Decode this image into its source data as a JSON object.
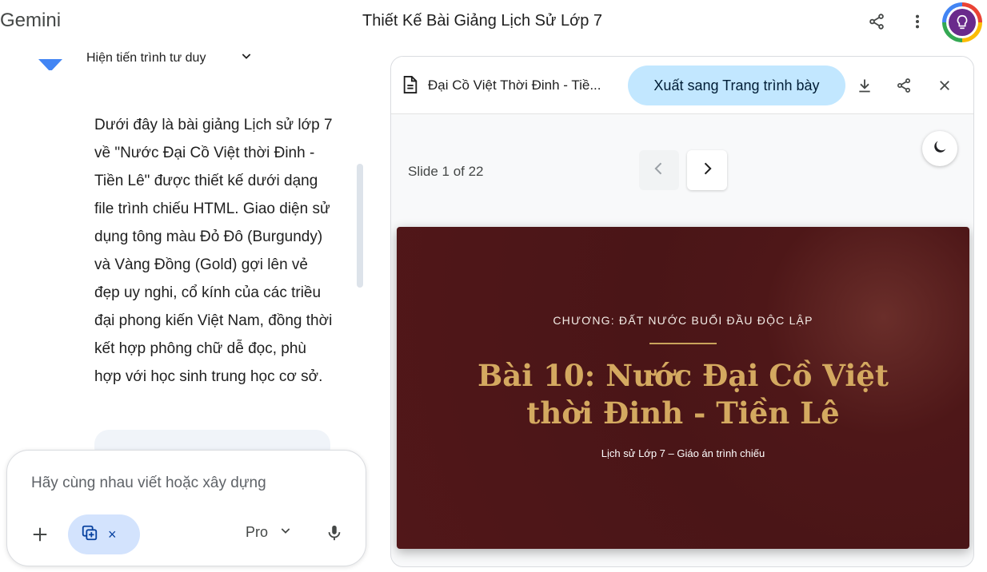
{
  "header": {
    "brand": "Gemini",
    "title": "Thiết Kế Bài Giảng Lịch Sử Lớp 7"
  },
  "chat": {
    "thinking_label": "Hiện tiến trình tư duy",
    "response_text": "Dưới đây là bài giảng Lịch sử lớp 7 về \"Nước Đại Cồ Việt thời Đinh - Tiền Lê\" được thiết kế dưới dạng file trình chiếu HTML. Giao diện sử dụng tông màu Đỏ Đô (Burgundy) và Vàng Đồng (Gold) gợi lên vẻ đẹp uy nghi, cổ kính của các triều đại phong kiến Việt Nam, đồng thời kết hợp phông chữ dễ đọc, phù hợp với học sinh trung học cơ sở."
  },
  "composer": {
    "placeholder": "Hãy cùng nhau viết hoặc xây dựng",
    "model_label": "Pro",
    "tool_close": "×"
  },
  "panel": {
    "doc_title": "Đại Cồ Việt Thời Đinh - Tiề...",
    "export_label": "Xuất sang Trang trình bày",
    "slide_counter": "Slide 1 of 22"
  },
  "slide": {
    "chapter": "CHƯƠNG: ĐẤT NƯỚC BUỔI ĐẦU ĐỘC LẬP",
    "title_line1": "Bài 10: Nước Đại Cồ Việt",
    "title_line2": "thời Đinh - Tiền Lê",
    "subtitle": "Lịch sử Lớp 7 – Giáo án trình chiếu"
  },
  "colors": {
    "slide_background": "#4e1718",
    "slide_gold": "#d4a960",
    "export_button": "#c2e7ff",
    "tool_chip": "#d3e3fd"
  },
  "icons": [
    "share-icon",
    "more-vert-icon",
    "avatar",
    "spark-icon",
    "chevron-down-icon",
    "document-icon",
    "download-icon",
    "close-icon",
    "chevron-left-icon",
    "chevron-right-icon",
    "moon-icon",
    "plus-icon",
    "canvas-tool-icon",
    "mic-icon"
  ]
}
